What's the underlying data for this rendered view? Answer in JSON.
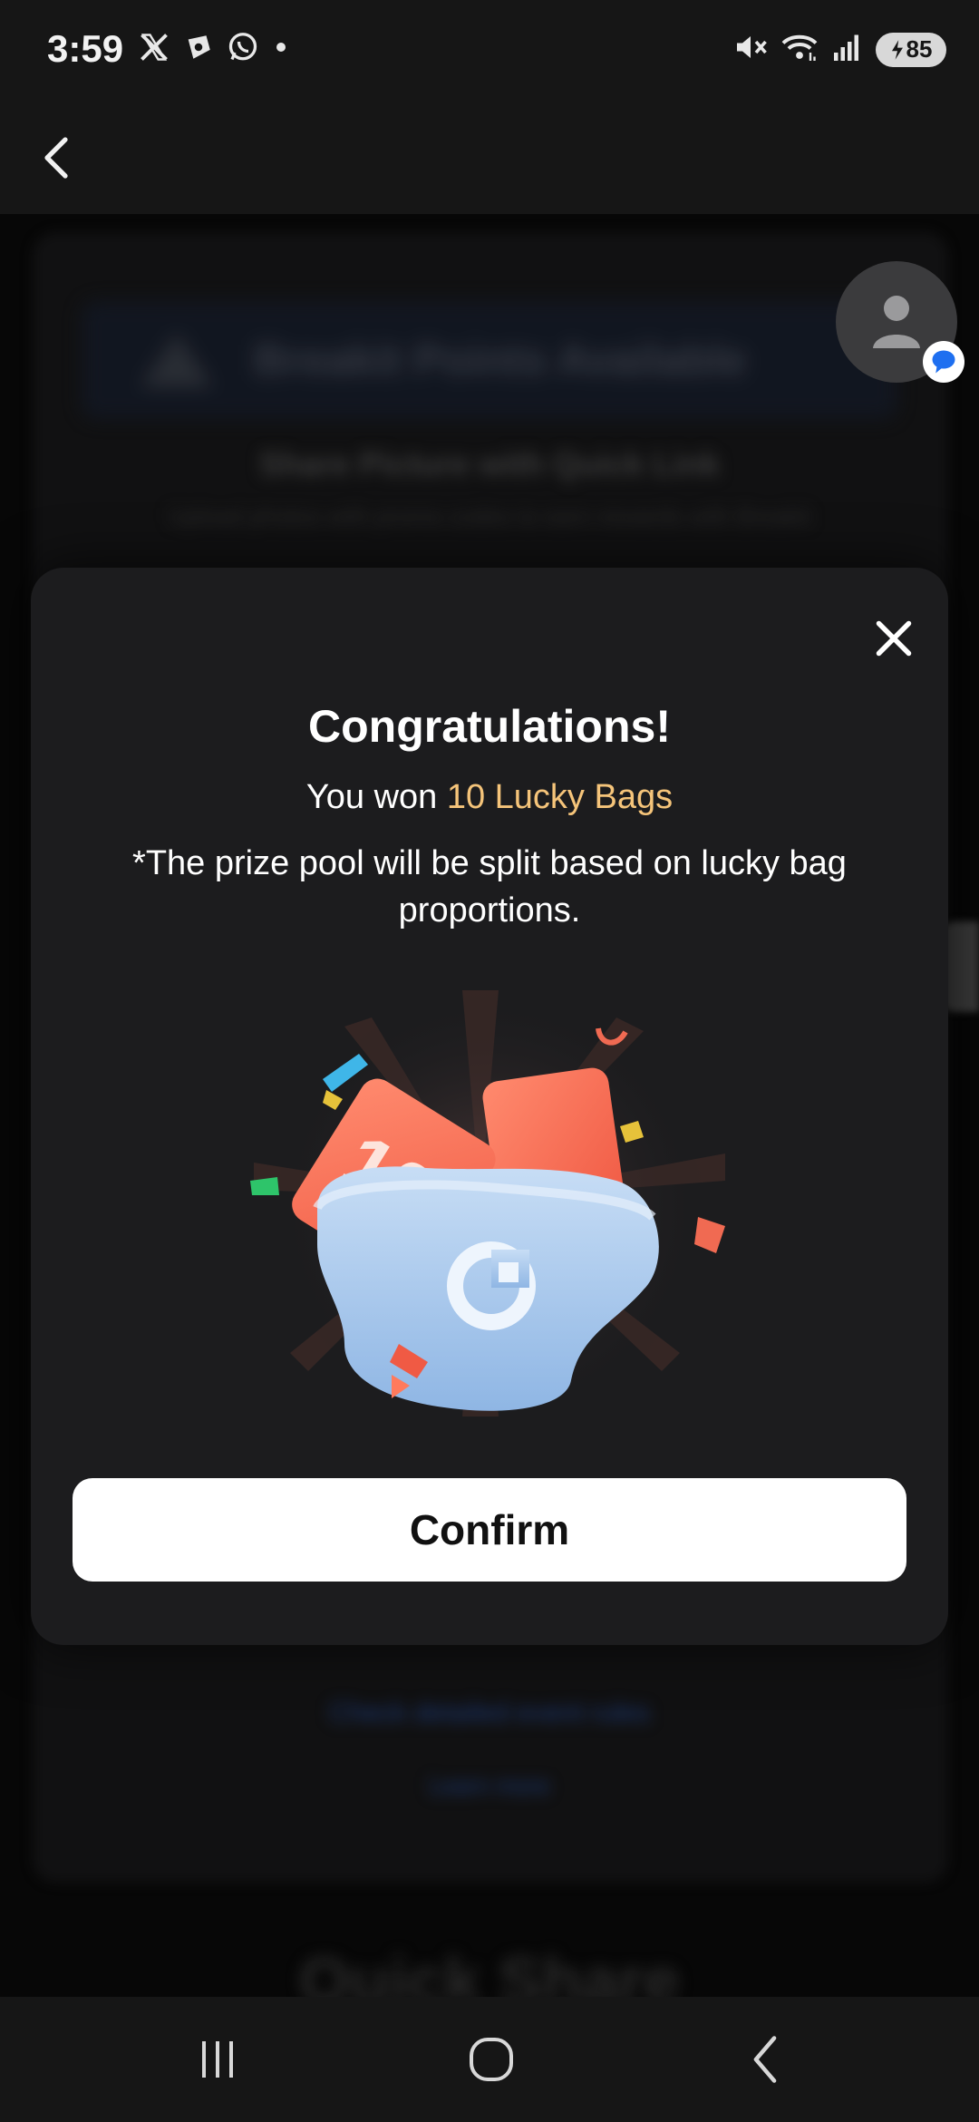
{
  "status_bar": {
    "time": "3:59",
    "battery": "85",
    "left_icons": [
      "x-icon",
      "play-games-icon",
      "whatsapp-icon",
      "dot-icon"
    ],
    "right_icons": [
      "mute-icon",
      "wifi-icon",
      "signal-icon",
      "battery-icon"
    ]
  },
  "modal": {
    "title": "Congratulations!",
    "won_prefix": "You won ",
    "won_highlight": "10 Lucky Bags",
    "note": "*The prize pool will be split based on lucky bag proportions.",
    "illustration_number": "10",
    "confirm_label": "Confirm",
    "highlight_color": "#f5c47a"
  },
  "background": {
    "banner_title": "Breakit Points Available",
    "subtitle": "Share Picture with Quick Link",
    "description": "Upload photos with promo codes to earn rewards with Breakit",
    "link1": "Check detailed event rules",
    "link2": "Learn more",
    "heading": "Quick Share"
  },
  "bottom_nav": {
    "icons": [
      "recents-icon",
      "home-icon",
      "back-icon"
    ]
  }
}
